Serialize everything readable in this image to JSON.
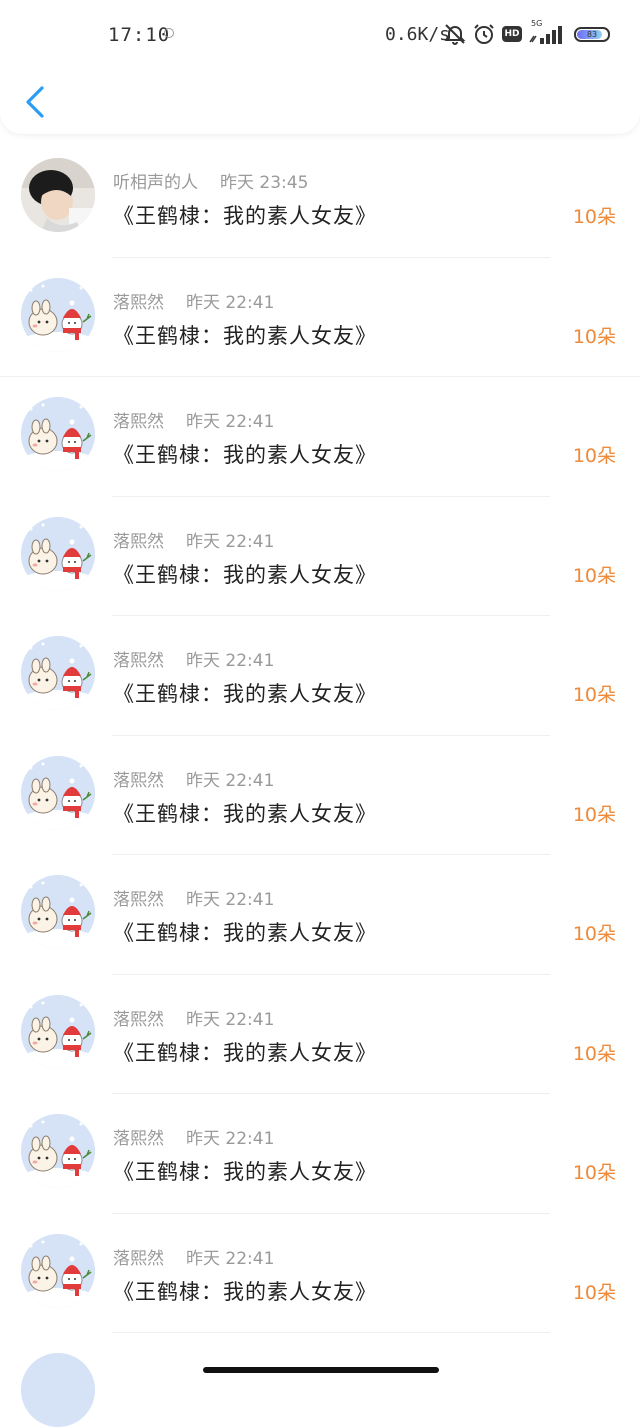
{
  "status_bar": {
    "time": "17:10",
    "net_speed": "0.6K/s",
    "hd_label": "HD",
    "signal_label": "5G",
    "battery": "83",
    "battery_level": 0.83
  },
  "nav": {
    "back_icon": "chevron-left-icon",
    "accent": "#2a9df4"
  },
  "count_color": "#ee8a3a",
  "entries": [
    {
      "user": "听相声的人",
      "time": "昨天 23:45",
      "title": "《王鹤棣：我的素人女友》",
      "count": "10朵",
      "avatar": "photo-avatar"
    },
    {
      "user": "落熙然",
      "time": "昨天 22:41",
      "title": "《王鹤棣：我的素人女友》",
      "count": "10朵",
      "avatar": "cartoon-avatar"
    },
    {
      "user": "落熙然",
      "time": "昨天 22:41",
      "title": "《王鹤棣：我的素人女友》",
      "count": "10朵",
      "avatar": "cartoon-avatar"
    },
    {
      "user": "落熙然",
      "time": "昨天 22:41",
      "title": "《王鹤棣：我的素人女友》",
      "count": "10朵",
      "avatar": "cartoon-avatar"
    },
    {
      "user": "落熙然",
      "time": "昨天 22:41",
      "title": "《王鹤棣：我的素人女友》",
      "count": "10朵",
      "avatar": "cartoon-avatar"
    },
    {
      "user": "落熙然",
      "time": "昨天 22:41",
      "title": "《王鹤棣：我的素人女友》",
      "count": "10朵",
      "avatar": "cartoon-avatar"
    },
    {
      "user": "落熙然",
      "time": "昨天 22:41",
      "title": "《王鹤棣：我的素人女友》",
      "count": "10朵",
      "avatar": "cartoon-avatar"
    },
    {
      "user": "落熙然",
      "time": "昨天 22:41",
      "title": "《王鹤棣：我的素人女友》",
      "count": "10朵",
      "avatar": "cartoon-avatar"
    },
    {
      "user": "落熙然",
      "time": "昨天 22:41",
      "title": "《王鹤棣：我的素人女友》",
      "count": "10朵",
      "avatar": "cartoon-avatar"
    },
    {
      "user": "落熙然",
      "time": "昨天 22:41",
      "title": "《王鹤棣：我的素人女友》",
      "count": "10朵",
      "avatar": "cartoon-avatar"
    }
  ]
}
